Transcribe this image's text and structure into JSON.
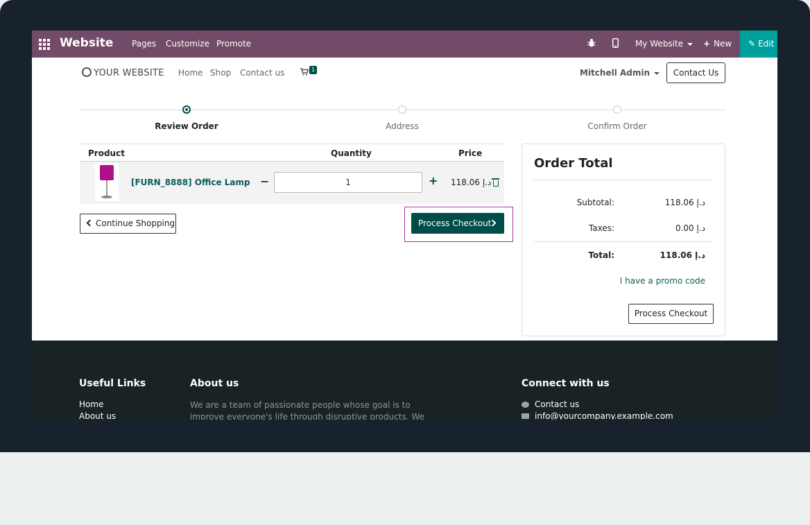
{
  "admin_bar": {
    "brand": "Website",
    "menu": [
      "Pages",
      "Customize",
      "Promote"
    ],
    "website_selector": "My Website",
    "new_label": "New",
    "edit_label": "Edit"
  },
  "site_nav": {
    "logo": "YOUR WEBSITE",
    "links": [
      "Home",
      "Shop",
      "Contact us"
    ],
    "cart_count": "1",
    "user": "Mitchell Admin",
    "contact_button": "Contact Us"
  },
  "steps": [
    {
      "label": "Review Order",
      "active": true
    },
    {
      "label": "Address",
      "active": false
    },
    {
      "label": "Confirm Order",
      "active": false
    }
  ],
  "cart_table": {
    "headers": [
      "Product",
      "Quantity",
      "Price"
    ],
    "rows": [
      {
        "name": "[FURN_8888] Office Lamp",
        "quantity": "1",
        "price": "118.06 د.إ"
      }
    ]
  },
  "actions": {
    "continue_shopping": "Continue Shopping",
    "process_checkout": "Process Checkout"
  },
  "order_total": {
    "title": "Order Total",
    "subtotal_label": "Subtotal:",
    "subtotal_value": "118.06 د.إ",
    "taxes_label": "Taxes:",
    "taxes_value": "0.00 د.إ",
    "total_label": "Total:",
    "total_value": "118.06 د.إ",
    "promo_link": "I have a promo code",
    "checkout_button": "Process Checkout"
  },
  "footer": {
    "useful_links_title": "Useful Links",
    "useful_links": [
      "Home",
      "About us"
    ],
    "about_title": "About us",
    "about_text": "We are a team of passionate people whose goal is to improve everyone's life through disruptive products. We build great",
    "connect_title": "Connect with us",
    "contact_label": "Contact us",
    "email": "info@yourcompany.example.com"
  },
  "colors": {
    "admin_bar": "#714b67",
    "edit_button": "#00a09d",
    "primary": "#004d48",
    "highlight": "#a933a3",
    "footer": "#1a2324"
  }
}
